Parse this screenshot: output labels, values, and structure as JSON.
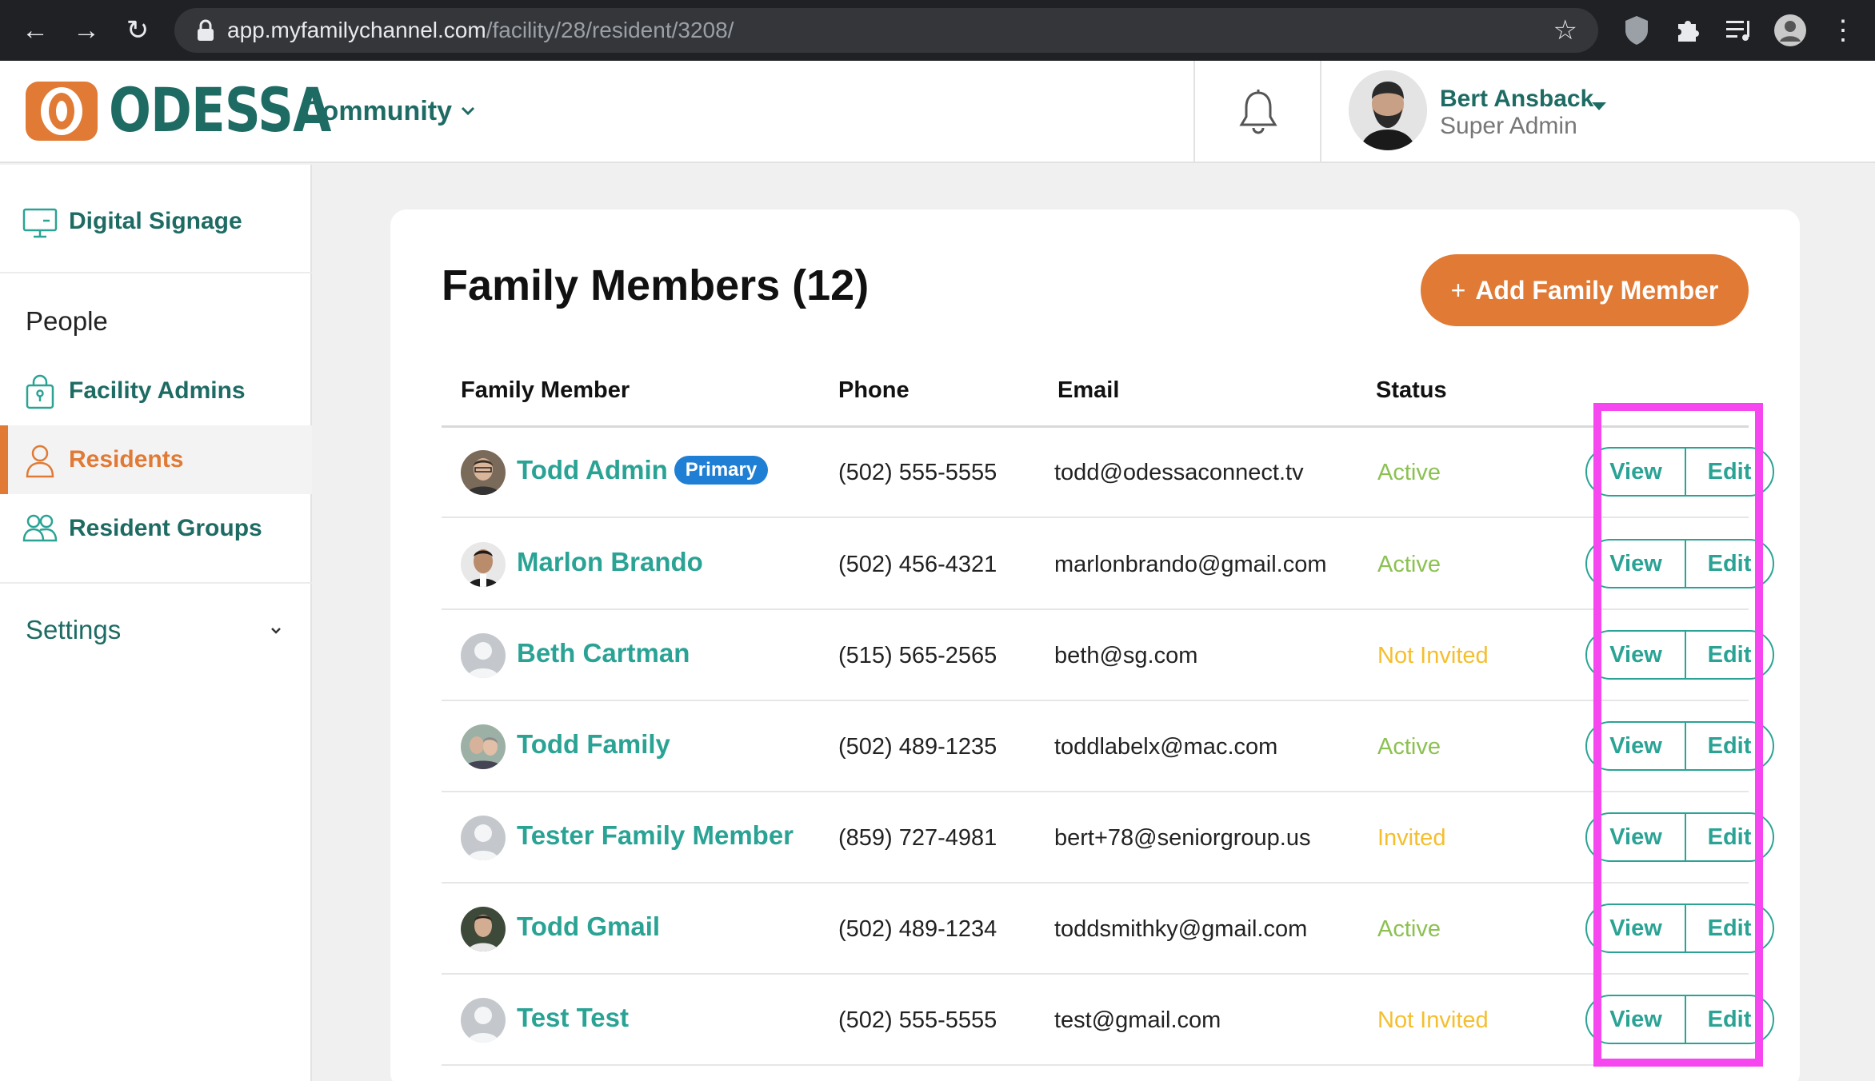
{
  "browser": {
    "url_domain": "app.myfamilychannel.com",
    "url_path": "/facility/28/resident/3208/"
  },
  "header": {
    "logo_text": "ODESSA",
    "community_label": "Community",
    "user_name": "Bert Ansback",
    "user_role": "Super Admin"
  },
  "sidebar": {
    "digital_signage": "Digital Signage",
    "people_heading": "People",
    "facility_admins": "Facility Admins",
    "residents": "Residents",
    "resident_groups": "Resident Groups",
    "settings": "Settings"
  },
  "main": {
    "title": "Family Members (12)",
    "add_button": "Add Family Member",
    "columns": {
      "member": "Family Member",
      "phone": "Phone",
      "email": "Email",
      "status": "Status"
    },
    "view_label": "View",
    "edit_label": "Edit",
    "primary_badge": "Primary",
    "rows": [
      {
        "name": "Todd Admin",
        "phone": "(502) 555-5555",
        "email": "todd@odessaconnect.tv",
        "status": "Active"
      },
      {
        "name": "Marlon Brando",
        "phone": "(502) 456-4321",
        "email": "marlonbrando@gmail.com",
        "status": "Active"
      },
      {
        "name": "Beth Cartman",
        "phone": "(515) 565-2565",
        "email": "beth@sg.com",
        "status": "Not Invited"
      },
      {
        "name": "Todd Family",
        "phone": "(502) 489-1235",
        "email": "toddlabelx@mac.com",
        "status": "Active"
      },
      {
        "name": "Tester Family Member",
        "phone": "(859) 727-4981",
        "email": "bert+78@seniorgroup.us",
        "status": "Invited"
      },
      {
        "name": "Todd Gmail",
        "phone": "(502) 489-1234",
        "email": "toddsmithky@gmail.com",
        "status": "Active"
      },
      {
        "name": "Test Test",
        "phone": "(502) 555-5555",
        "email": "test@gmail.com",
        "status": "Not Invited"
      }
    ]
  },
  "colors": {
    "brand_teal": "#1e6b64",
    "link_teal": "#2aa395",
    "accent_orange": "#e07a35",
    "status_active": "#8cc152",
    "status_pending": "#f5be2d",
    "primary_badge": "#1f7fd4",
    "highlight_magenta": "#f546f0"
  },
  "icons": {
    "back": "arrow-left-icon",
    "forward": "arrow-right-icon",
    "reload": "reload-icon",
    "bookmark": "star-icon",
    "notifications": "bell-icon",
    "digital_signage": "monitor-icon",
    "facility_admins": "lock-badge-icon",
    "residents": "person-icon",
    "resident_groups": "people-icon"
  }
}
